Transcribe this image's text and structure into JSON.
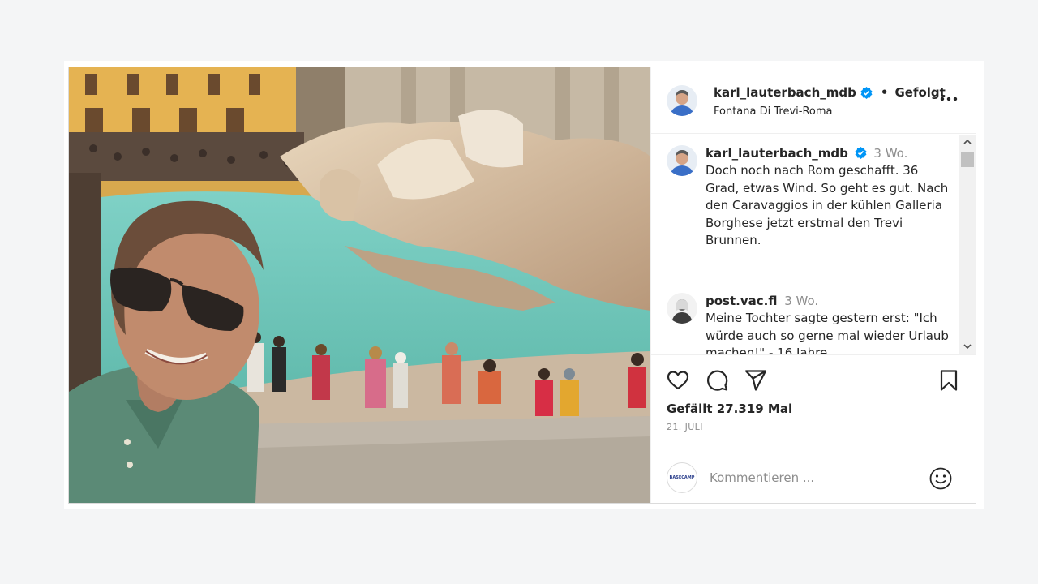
{
  "post": {
    "username": "karl_lauterbach_mdb",
    "follow_status": "Gefolgt",
    "separator": "•",
    "location": "Fontana Di Trevi-Roma",
    "photo_alt": "Selfie vor dem Trevi-Brunnen"
  },
  "comments": [
    {
      "username": "karl_lauterbach_mdb",
      "time": "3 Wo.",
      "text": "Doch noch nach Rom geschafft. 36 Grad, etwas Wind. So geht es gut. Nach den Caravaggios in der kühlen Galleria Borghese jetzt erstmal den Trevi Brunnen.",
      "verified": true
    },
    {
      "username": "post.vac.fl",
      "time": "3 Wo.",
      "text": "Meine Tochter sagte gestern erst: \"Ich würde auch so gerne mal wieder Urlaub machen!\" - 16 Jahre",
      "verified": false
    }
  ],
  "actions": {
    "likes": "Gefällt 27.319 Mal",
    "date": "21. JULI",
    "icons": [
      "heart-icon",
      "comment-icon",
      "share-icon",
      "bookmark-icon"
    ]
  },
  "comment_bar": {
    "avatar_text": "BASECAMP",
    "placeholder": "Kommentieren ..."
  },
  "colors": {
    "verified": "#0095f6",
    "border": "#dbdbdb",
    "muted": "#8e8e8e",
    "text": "#262626"
  }
}
